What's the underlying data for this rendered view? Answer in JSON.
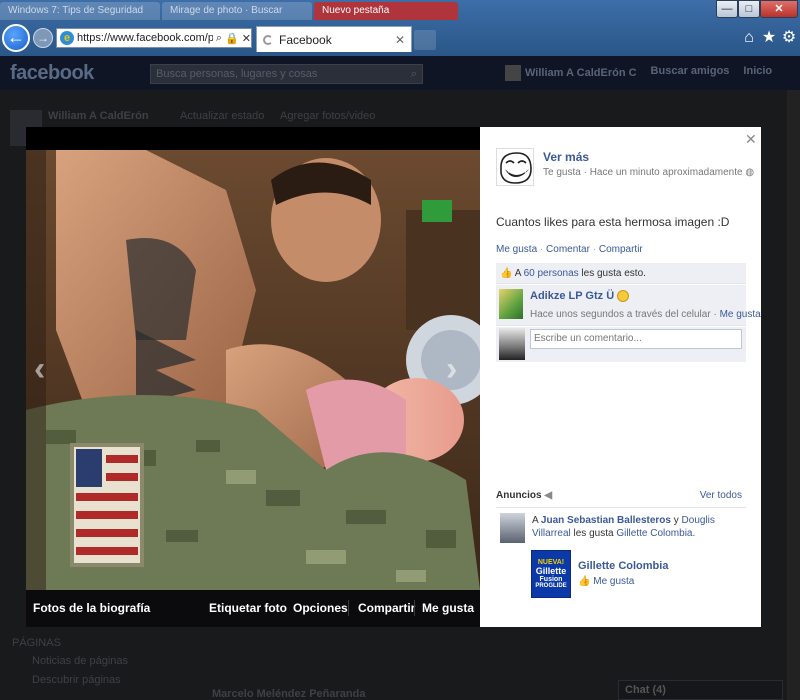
{
  "browser": {
    "background_tabs": [
      "Windows 7: Tips de Seguridad",
      "Mirage de photo · Buscar",
      "Nuevo pestaña"
    ],
    "address": "https://www.facebook.com/p",
    "active_tab": "Facebook",
    "window_buttons": {
      "minimize": "—",
      "maximize": "□",
      "close": "✕"
    }
  },
  "facebook": {
    "logo": "facebook",
    "search_placeholder": "Busca personas, lugares y cosas",
    "user_name": "William A CaldErón C",
    "nav": [
      "Buscar amigos",
      "Inicio"
    ],
    "background_page": {
      "profile_name": "William A CaldErón",
      "update_status": "Actualizar estado",
      "add_photos": "Agregar fotos/video",
      "sections": [
        "Noticias de páginas",
        "Descubrir páginas",
        "PÁGINAS"
      ],
      "post_author": "Marcelo Meléndez Peñaranda",
      "chat": "Chat (4)"
    }
  },
  "photo_viewer": {
    "toolbar": {
      "album": "Fotos de la biografía",
      "tag": "Etiquetar foto",
      "options": "Opciones",
      "share": "Compartir",
      "like": "Me gusta"
    },
    "post": {
      "author": "Ver más",
      "meta": "Te gusta · Hace un minuto aproximadamente",
      "caption": "Cuantos likes para esta hermosa imagen :D",
      "actions": [
        "Me gusta",
        "Comentar",
        "Compartir"
      ],
      "likes_prefix": "A",
      "likes_link": "60 personas",
      "likes_suffix": "les gusta esto.",
      "comment": {
        "author": "Adikze LP Gtz Ü",
        "meta": "Hace unos segundos a través del celular ·",
        "like": "Me gusta"
      },
      "comment_placeholder": "Escribe un comentario..."
    },
    "ads": {
      "heading": "Anuncios",
      "see_all": "Ver todos",
      "social": {
        "prefix": "A",
        "person1": "Juan Sebastian Ballesteros",
        "joiner": "y",
        "person2": "Douglis Villarreal",
        "middle": "les gusta",
        "page": "Gillette Colombia."
      },
      "sponsored": {
        "title": "Gillette Colombia",
        "like": "Me gusta",
        "image_text_top": "NUEVA!",
        "image_text_brand": "Gillette",
        "image_text_line": "Fusion",
        "image_text_bottom": "PROGLIDE"
      }
    }
  }
}
